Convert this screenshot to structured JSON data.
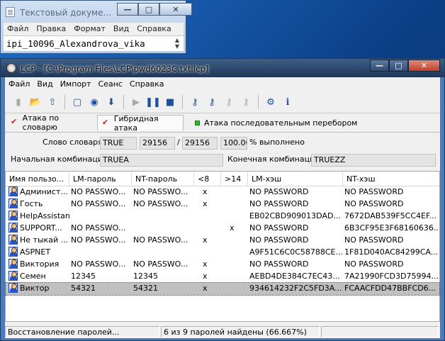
{
  "notepad": {
    "title": "Текстовый докуме...",
    "menu": [
      "Файл",
      "Правка",
      "Формат",
      "Вид",
      "Справка"
    ],
    "content": "ipi_10096_Alexandrova_vika",
    "buttons": {
      "minimize": "—",
      "maximize": "□",
      "close": "✕"
    }
  },
  "lcp": {
    "title": "LCP - [C:\\Program Files\\LCP\\pwd6023C.txt.lcp]",
    "buttons": {
      "minimize": "—",
      "maximize": "□",
      "close": "✕"
    },
    "menu": [
      "Файл",
      "Вид",
      "Импорт",
      "Сеанс",
      "Справка"
    ],
    "toolbar_icons": [
      {
        "name": "new-icon",
        "glyph": "▮",
        "disabled": true
      },
      {
        "name": "open-icon",
        "glyph": "📂",
        "disabled": false
      },
      {
        "name": "save-icon",
        "glyph": "⇧",
        "disabled": false
      },
      {
        "name": "import-local-icon",
        "glyph": "▢",
        "disabled": false
      },
      {
        "name": "import-remote-icon",
        "glyph": "◉",
        "disabled": false
      },
      {
        "name": "download-icon",
        "glyph": "⬇",
        "disabled": false
      },
      {
        "name": "play-icon",
        "glyph": "▶",
        "disabled": true
      },
      {
        "name": "pause-icon",
        "glyph": "❚❚",
        "disabled": false
      },
      {
        "name": "stop-icon",
        "glyph": "■",
        "disabled": false
      },
      {
        "name": "lm-key-icon",
        "glyph": "⚷",
        "disabled": false
      },
      {
        "name": "nt-key-icon",
        "glyph": "⚷",
        "disabled": false
      },
      {
        "name": "lm-key-disabled-icon",
        "glyph": "⚷",
        "disabled": true
      },
      {
        "name": "nt-key-disabled-icon",
        "glyph": "⚷",
        "disabled": true
      },
      {
        "name": "options-icon",
        "glyph": "⚙",
        "disabled": false
      },
      {
        "name": "help-icon",
        "glyph": "ℹ",
        "disabled": false
      }
    ],
    "tabs": [
      {
        "label": "Атака по словарю",
        "marker": "red",
        "active": false
      },
      {
        "label": "Гибридная атака",
        "marker": "red",
        "active": true
      },
      {
        "label": "Атака последовательным перебором",
        "marker": "green",
        "active": false
      }
    ],
    "info": {
      "dict_word_label": "Слово словаря:",
      "dict_word": "TRUE",
      "progress_current": "29156",
      "separator": "/",
      "progress_total": "29156",
      "percent": "100.00",
      "percent_suffix": "% выполнено",
      "start_label": "Начальная комбинация:",
      "start_value": "TRUEA",
      "end_label": "Конечная комбинация:",
      "end_value": "TRUEZZ"
    },
    "table": {
      "columns": [
        "Имя пользо...",
        "LM-пароль",
        "NT-пароль",
        "<8",
        ">14",
        "LM-хэш",
        "NT-хэш"
      ],
      "rows": [
        {
          "user": "Админист...",
          "lm": "NO PASSWO...",
          "nt": "NO PASSWO...",
          "lt8": "x",
          "gt14": "",
          "lmhash": "NO PASSWORD",
          "nthash": "NO PASSWORD",
          "selected": false
        },
        {
          "user": "Гость",
          "lm": "NO PASSWO...",
          "nt": "NO PASSWO...",
          "lt8": "x",
          "gt14": "",
          "lmhash": "NO PASSWORD",
          "nthash": "NO PASSWORD",
          "selected": false
        },
        {
          "user": "HelpAssistant",
          "lm": "",
          "nt": "",
          "lt8": "",
          "gt14": "",
          "lmhash": "EB02CBD909013DAD...",
          "nthash": "7672DAB539F5CC4EF...",
          "selected": false
        },
        {
          "user": "SUPPORT...",
          "lm": "NO PASSWO...",
          "nt": "",
          "lt8": "",
          "gt14": "x",
          "lmhash": "NO PASSWORD",
          "nthash": "6B3CF95E3F68160636...",
          "selected": false
        },
        {
          "user": "Не тыкай ...",
          "lm": "NO PASSWO...",
          "nt": "NO PASSWO...",
          "lt8": "x",
          "gt14": "",
          "lmhash": "NO PASSWORD",
          "nthash": "NO PASSWORD",
          "selected": false
        },
        {
          "user": "ASPNET",
          "lm": "",
          "nt": "",
          "lt8": "",
          "gt14": "",
          "lmhash": "A9F51C6C0C58788CE...",
          "nthash": "1F81D040AC84299CA...",
          "selected": false
        },
        {
          "user": "Виктория",
          "lm": "NO PASSWO...",
          "nt": "NO PASSWO...",
          "lt8": "x",
          "gt14": "",
          "lmhash": "NO PASSWORD",
          "nthash": "NO PASSWORD",
          "selected": false
        },
        {
          "user": "Семен",
          "lm": "12345",
          "nt": "12345",
          "lt8": "x",
          "gt14": "",
          "lmhash": "AEBD4DE384C7EC43...",
          "nthash": "7A21990FCD3D75994...",
          "selected": false
        },
        {
          "user": "Виктор",
          "lm": "54321",
          "nt": "54321",
          "lt8": "x",
          "gt14": "",
          "lmhash": "934614232F2C5FD3A...",
          "nthash": "FCAACFDD47BBFCD6...",
          "selected": true
        }
      ]
    },
    "status": {
      "left": "Восстановление паролей...",
      "middle": "6 из 9 паролей найдены (66.667%)",
      "right": ""
    }
  }
}
